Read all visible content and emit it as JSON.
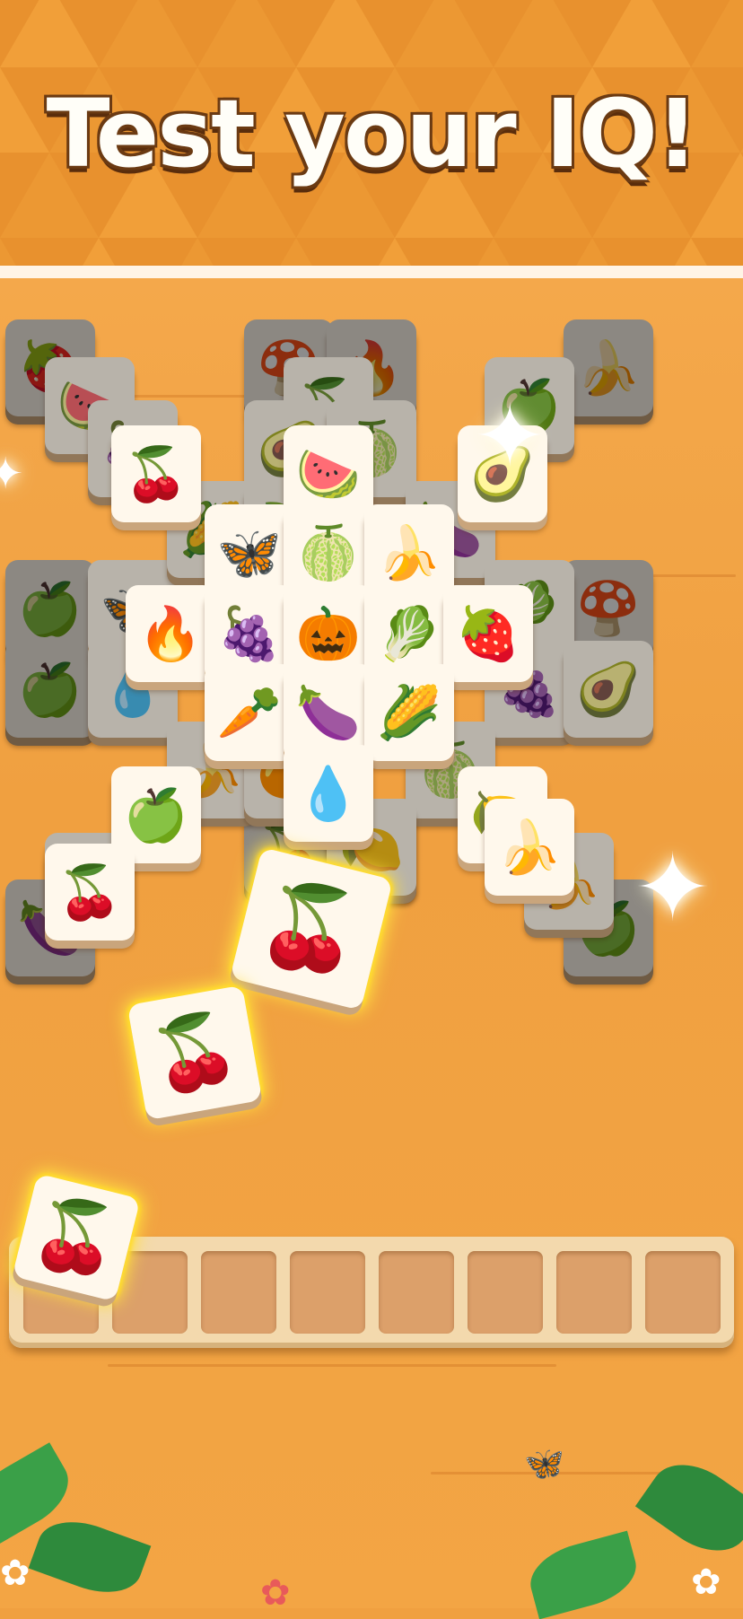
{
  "banner": {
    "headline": "Test your IQ!",
    "colors": {
      "background": "#e8912e",
      "triangle": "#f2a23c",
      "text": "#fffef8",
      "outline": "#6b3a12"
    }
  },
  "board": {
    "background": "#f0a040",
    "layers": {
      "back": [
        {
          "fruit": "strawberry",
          "glyph": "🍓"
        },
        {
          "fruit": "mushroom",
          "glyph": "🍄"
        },
        {
          "fruit": "fire",
          "glyph": "🔥"
        },
        {
          "fruit": "banana",
          "glyph": "🍌"
        },
        {
          "fruit": "apple",
          "glyph": "🍏"
        },
        {
          "fruit": "mushroom",
          "glyph": "🍄"
        },
        {
          "fruit": "apple",
          "glyph": "🍏"
        },
        {
          "fruit": "cherry",
          "glyph": "🍒"
        },
        {
          "fruit": "lemon",
          "glyph": "🍋"
        },
        {
          "fruit": "eggplant",
          "glyph": "🍆"
        },
        {
          "fruit": "apple",
          "glyph": "🍏"
        }
      ],
      "middle": [
        {
          "fruit": "watermelon",
          "glyph": "🍉"
        },
        {
          "fruit": "cherry",
          "glyph": "🍒"
        },
        {
          "fruit": "grapes",
          "glyph": "🍇"
        },
        {
          "fruit": "avocado",
          "glyph": "🥑"
        },
        {
          "fruit": "dragonfruit",
          "glyph": "🍈"
        },
        {
          "fruit": "apple",
          "glyph": "🍏"
        },
        {
          "fruit": "butterfly",
          "glyph": "🦋"
        },
        {
          "fruit": "water",
          "glyph": "💧"
        },
        {
          "fruit": "corn",
          "glyph": "🌽"
        },
        {
          "fruit": "eggplant",
          "glyph": "🍆"
        },
        {
          "fruit": "cabbage",
          "glyph": "🥬"
        },
        {
          "fruit": "grapes",
          "glyph": "🍇"
        },
        {
          "fruit": "avocado",
          "glyph": "🥑"
        },
        {
          "fruit": "banana",
          "glyph": "🍌"
        },
        {
          "fruit": "orange",
          "glyph": "🍊"
        },
        {
          "fruit": "dragonfruit",
          "glyph": "🍈"
        },
        {
          "fruit": "lemon",
          "glyph": "🍋"
        },
        {
          "fruit": "banana",
          "glyph": "🍌"
        },
        {
          "fruit": "lemon",
          "glyph": "🍋"
        },
        {
          "fruit": "peach",
          "glyph": "🍑"
        }
      ],
      "top": [
        {
          "fruit": "cherry",
          "glyph": "🍒"
        },
        {
          "fruit": "watermelon",
          "glyph": "🍉"
        },
        {
          "fruit": "avocado",
          "glyph": "🥑"
        },
        {
          "fruit": "butterfly",
          "glyph": "🦋"
        },
        {
          "fruit": "dragonfruit",
          "glyph": "🍈"
        },
        {
          "fruit": "banana",
          "glyph": "🍌"
        },
        {
          "fruit": "fire",
          "glyph": "🔥"
        },
        {
          "fruit": "grapes",
          "glyph": "🍇"
        },
        {
          "fruit": "orange",
          "glyph": "🎃"
        },
        {
          "fruit": "cabbage",
          "glyph": "🥬"
        },
        {
          "fruit": "strawberry",
          "glyph": "🍓"
        },
        {
          "fruit": "carrot",
          "glyph": "🥕"
        },
        {
          "fruit": "eggplant",
          "glyph": "🍆"
        },
        {
          "fruit": "corn",
          "glyph": "🌽"
        },
        {
          "fruit": "water",
          "glyph": "💧"
        },
        {
          "fruit": "apple",
          "glyph": "🍏"
        },
        {
          "fruit": "lemon",
          "glyph": "🍋"
        },
        {
          "fruit": "banana",
          "glyph": "🍌"
        },
        {
          "fruit": "cherry",
          "glyph": "🍒"
        }
      ]
    },
    "flying_tiles": [
      {
        "fruit": "cherry",
        "glyph": "🍒"
      },
      {
        "fruit": "cherry",
        "glyph": "🍒"
      }
    ]
  },
  "tray": {
    "slot_count": 8,
    "filled": [],
    "colors": {
      "frame": "#f3d9ad",
      "slot": "#dca06a"
    }
  },
  "decor": {
    "sparkle_glyph": "✦",
    "butterfly_glyph": "🦋",
    "flower_glyph": "✿"
  }
}
